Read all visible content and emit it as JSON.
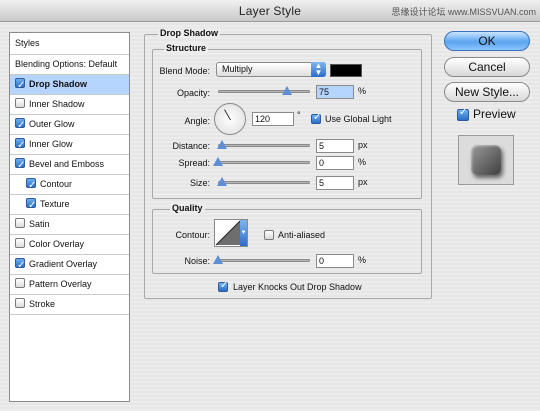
{
  "window": {
    "title": "Layer Style",
    "watermark": "思缘设计论坛 www.MISSVUAN.com"
  },
  "styles_panel": {
    "header": "Styles",
    "blending_options": "Blending Options: Default",
    "items": [
      {
        "label": "Drop Shadow",
        "checked": true,
        "selected": true,
        "indent": false
      },
      {
        "label": "Inner Shadow",
        "checked": false,
        "selected": false,
        "indent": false
      },
      {
        "label": "Outer Glow",
        "checked": true,
        "selected": false,
        "indent": false
      },
      {
        "label": "Inner Glow",
        "checked": true,
        "selected": false,
        "indent": false
      },
      {
        "label": "Bevel and Emboss",
        "checked": true,
        "selected": false,
        "indent": false
      },
      {
        "label": "Contour",
        "checked": true,
        "selected": false,
        "indent": true
      },
      {
        "label": "Texture",
        "checked": true,
        "selected": false,
        "indent": true
      },
      {
        "label": "Satin",
        "checked": false,
        "selected": false,
        "indent": false
      },
      {
        "label": "Color Overlay",
        "checked": false,
        "selected": false,
        "indent": false
      },
      {
        "label": "Gradient Overlay",
        "checked": true,
        "selected": false,
        "indent": false
      },
      {
        "label": "Pattern Overlay",
        "checked": false,
        "selected": false,
        "indent": false
      },
      {
        "label": "Stroke",
        "checked": false,
        "selected": false,
        "indent": false
      }
    ]
  },
  "drop_shadow": {
    "section_title": "Drop Shadow",
    "structure_title": "Structure",
    "blend_mode_label": "Blend Mode:",
    "blend_mode_value": "Multiply",
    "shadow_color": "#000000",
    "opacity_label": "Opacity:",
    "opacity_value": "75",
    "opacity_unit": "%",
    "opacity_level": 0.75,
    "angle_label": "Angle:",
    "angle_value": "120",
    "angle_unit": "°",
    "use_global_light_label": "Use Global Light",
    "use_global_light_checked": true,
    "distance_label": "Distance:",
    "distance_value": "5",
    "distance_unit": "px",
    "spread_label": "Spread:",
    "spread_value": "0",
    "spread_unit": "%",
    "size_label": "Size:",
    "size_value": "5",
    "size_unit": "px",
    "quality_title": "Quality",
    "contour_label": "Contour:",
    "anti_aliased_label": "Anti-aliased",
    "anti_aliased_checked": false,
    "noise_label": "Noise:",
    "noise_value": "0",
    "noise_unit": "%",
    "layer_knocks_out_label": "Layer Knocks Out Drop Shadow",
    "layer_knocks_out_checked": true
  },
  "buttons": {
    "ok": "OK",
    "cancel": "Cancel",
    "new_style": "New Style...",
    "preview_label": "Preview",
    "preview_checked": true
  },
  "colors": {
    "accent": "#5aa4ee",
    "selection": "#b5d5ff"
  }
}
